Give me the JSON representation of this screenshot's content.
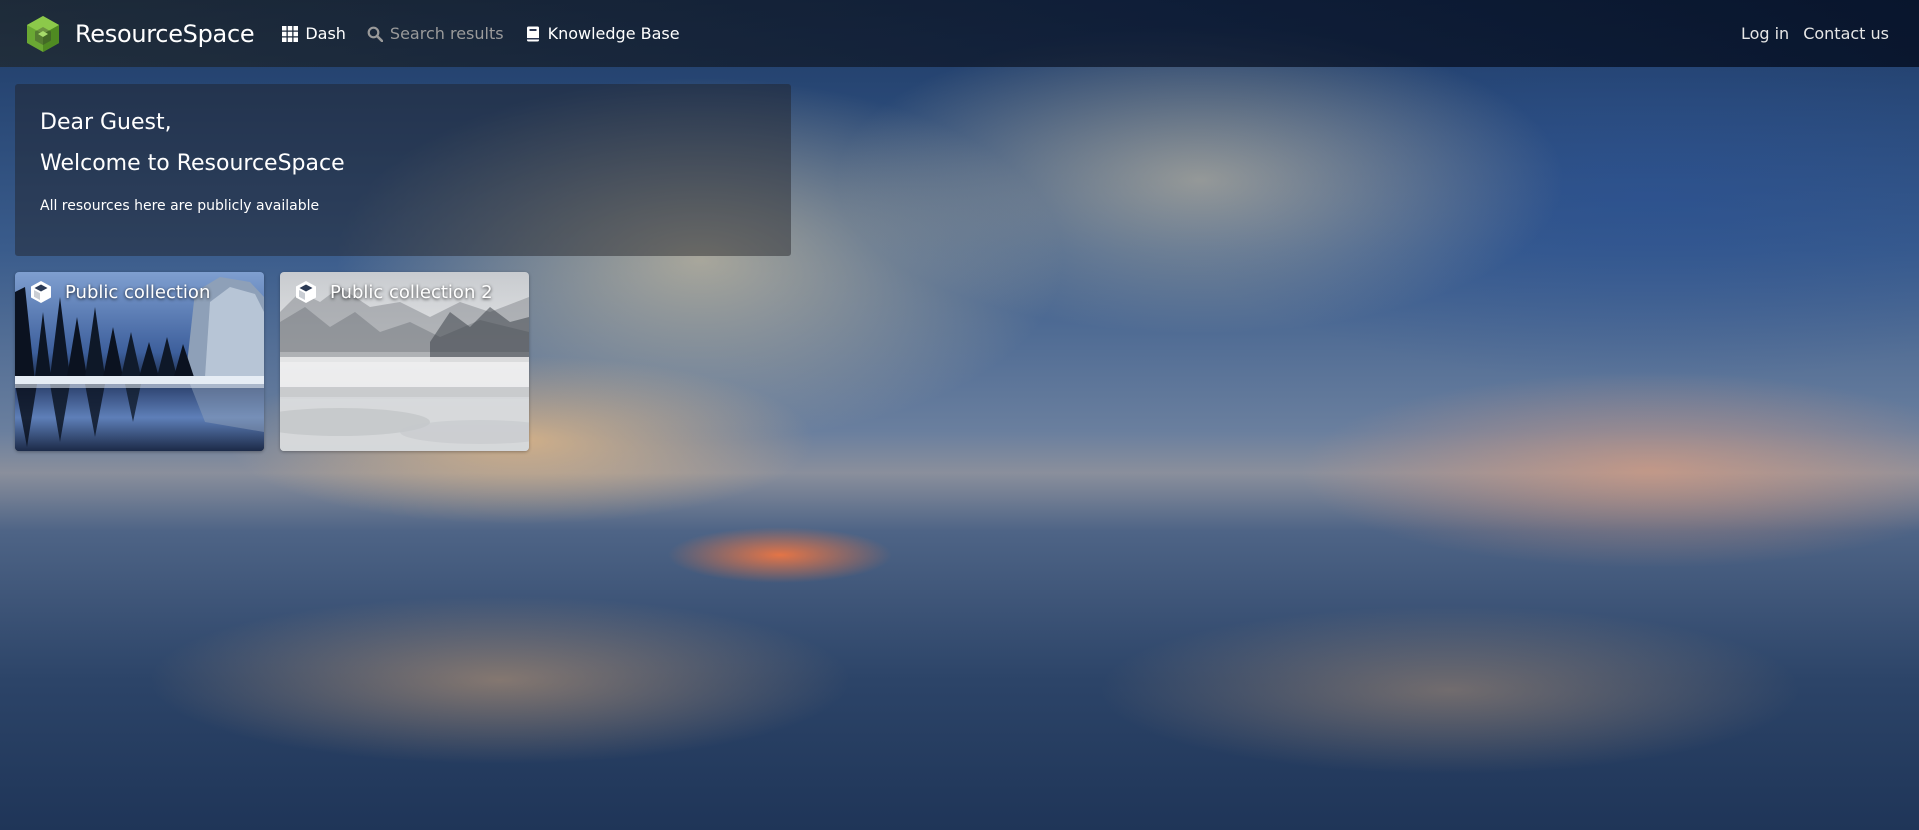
{
  "app": {
    "name": "ResourceSpace",
    "brand_color": "#6aa833"
  },
  "nav": {
    "items": [
      {
        "label": "Dash",
        "icon": "grid-icon",
        "active": true
      },
      {
        "label": "Search results",
        "icon": "search-icon",
        "active": false
      },
      {
        "label": "Knowledge Base",
        "icon": "book-icon",
        "active": true
      }
    ],
    "right": [
      {
        "label": "Log in"
      },
      {
        "label": "Contact us"
      }
    ]
  },
  "welcome": {
    "greeting": "Dear Guest,",
    "title": "Welcome to ResourceSpace",
    "text": "All resources here are publicly available"
  },
  "tiles": [
    {
      "title": "Public collection",
      "icon": "cube-icon",
      "image": "snowy-forest-lake"
    },
    {
      "title": "Public collection 2",
      "icon": "cube-icon",
      "image": "misty-mountains"
    }
  ]
}
